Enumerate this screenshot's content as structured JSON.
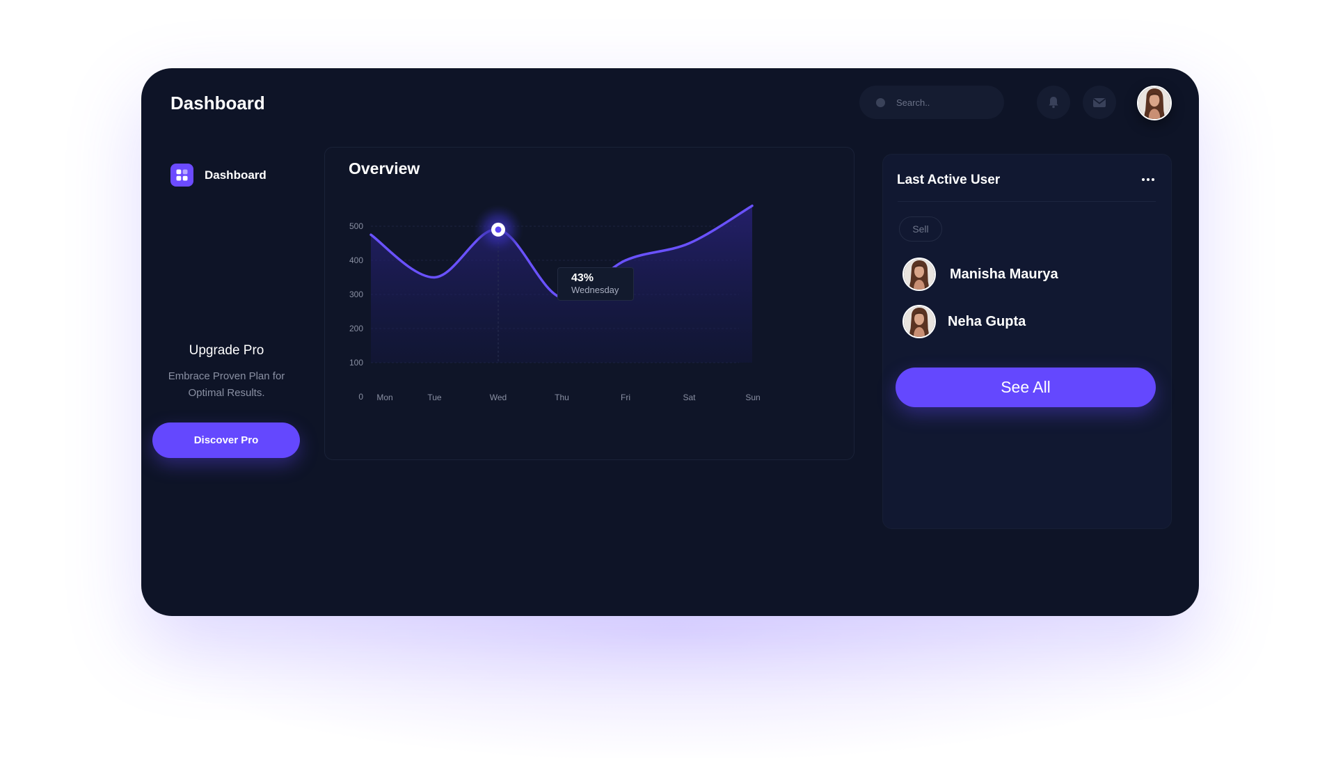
{
  "header": {
    "title": "Dashboard",
    "search_placeholder": "Search..",
    "icons": [
      "bell-icon",
      "mail-icon",
      "user-avatar"
    ]
  },
  "sidebar": {
    "items": [
      {
        "label": "Dashboard",
        "icon": "grid-icon",
        "active": true
      }
    ],
    "upgrade": {
      "title": "Upgrade Pro",
      "description": "Embrace Proven Plan for Optimal Results.",
      "button_label": "Discover Pro"
    }
  },
  "overview": {
    "title": "Overview",
    "tooltip": {
      "value": "43%",
      "label": "Wednesday"
    }
  },
  "chart_data": {
    "type": "area",
    "title": "Overview",
    "categories": [
      "Mon",
      "Tue",
      "Wed",
      "Thu",
      "Fri",
      "Sat",
      "Sun"
    ],
    "y_ticks": [
      "0",
      "100",
      "200",
      "300",
      "400",
      "500"
    ],
    "ylim": [
      0,
      500
    ],
    "series": [
      {
        "values": [
          475,
          350,
          490,
          290,
          400,
          450,
          560
        ]
      }
    ],
    "highlight": {
      "category": "Wed",
      "value": "43%",
      "label": "Wednesday"
    },
    "grid": true,
    "colors": {
      "line": "#6a52ff",
      "area": "#241e6a"
    }
  },
  "panel": {
    "title": "Last Active User",
    "chip": "Sell",
    "users": [
      {
        "name": "Manisha Maurya"
      },
      {
        "name": "Neha Gupta"
      }
    ],
    "see_all_label": "See All"
  },
  "colors": {
    "background": "#0e1427",
    "accent": "#6448fe",
    "text": "#ffffff",
    "muted": "#8a90a3"
  }
}
